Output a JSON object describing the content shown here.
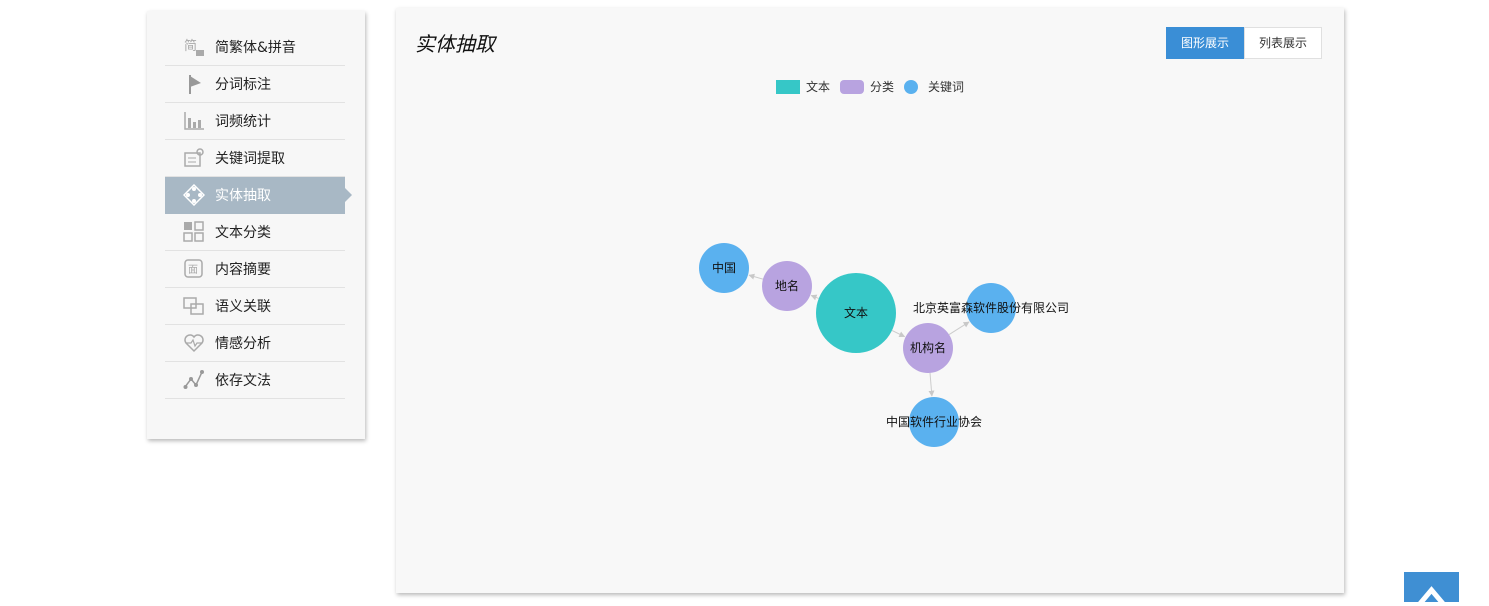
{
  "sidebar": {
    "items": [
      {
        "label": "简繁体&拼音",
        "icon": "traditional-simplified-icon"
      },
      {
        "label": "分词标注",
        "icon": "flag-icon"
      },
      {
        "label": "词频统计",
        "icon": "bar-chart-icon"
      },
      {
        "label": "关键词提取",
        "icon": "keyword-extract-icon"
      },
      {
        "label": "实体抽取",
        "icon": "entity-diamond-icon",
        "active": true
      },
      {
        "label": "文本分类",
        "icon": "grid-icon"
      },
      {
        "label": "内容摘要",
        "icon": "summary-icon"
      },
      {
        "label": "语义关联",
        "icon": "link-squares-icon"
      },
      {
        "label": "情感分析",
        "icon": "heart-icon"
      },
      {
        "label": "依存文法",
        "icon": "dependency-icon"
      }
    ]
  },
  "main": {
    "title": "实体抽取",
    "view_toggle": {
      "graph_label": "图形展示",
      "list_label": "列表展示",
      "active": "graph"
    },
    "legend": [
      {
        "label": "文本",
        "color": "#36c7c7",
        "shape": "rect"
      },
      {
        "label": "分类",
        "color": "#b8a3e0",
        "shape": "round-rect"
      },
      {
        "label": "关键词",
        "color": "#5ab1ef",
        "shape": "circle"
      }
    ],
    "graph": {
      "nodes": [
        {
          "id": "text",
          "label": "文本",
          "category": "文本",
          "color": "#36c7c7"
        },
        {
          "id": "place",
          "label": "地名",
          "category": "分类",
          "color": "#b8a3e0"
        },
        {
          "id": "org",
          "label": "机构名",
          "category": "分类",
          "color": "#b8a3e0"
        },
        {
          "id": "china",
          "label": "中国",
          "category": "关键词",
          "color": "#5ab1ef"
        },
        {
          "id": "bj",
          "label": "北京英富森软件股份有限公司",
          "category": "关键词",
          "color": "#5ab1ef"
        },
        {
          "id": "csia",
          "label": "中国软件行业协会",
          "category": "关键词",
          "color": "#5ab1ef"
        }
      ],
      "edges": [
        {
          "from": "text",
          "to": "place"
        },
        {
          "from": "place",
          "to": "china"
        },
        {
          "from": "text",
          "to": "org"
        },
        {
          "from": "org",
          "to": "bj"
        },
        {
          "from": "org",
          "to": "csia"
        }
      ]
    }
  },
  "back_to_top": {
    "icon": "chevron-up-icon"
  }
}
